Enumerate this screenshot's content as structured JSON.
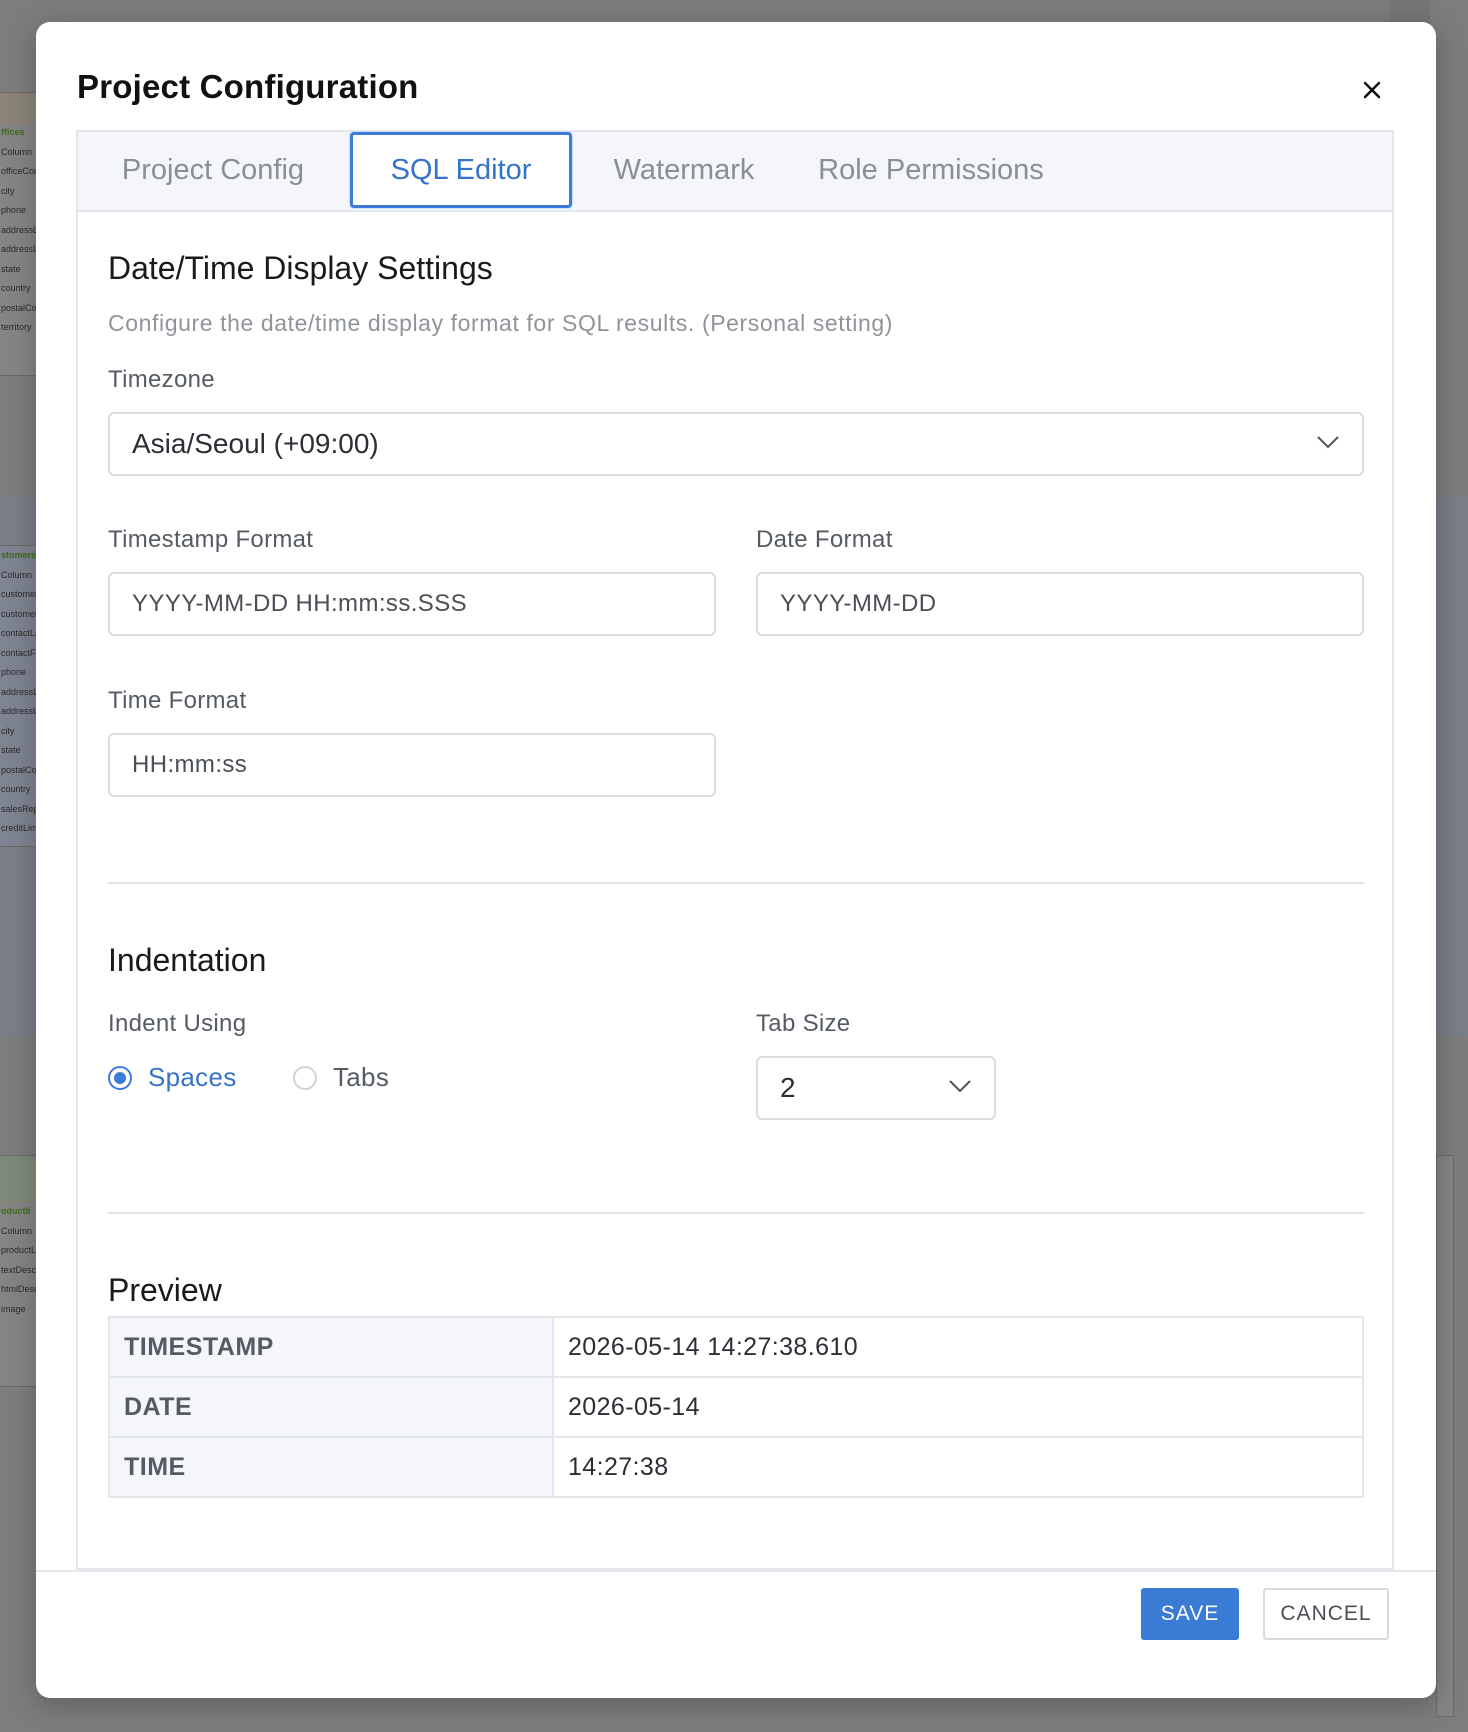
{
  "background": {
    "panel_1_title": "ffices",
    "panel_1_rows": [
      "Column",
      "officeCod",
      "city",
      "phone",
      "addressLi",
      "addressLi",
      "state",
      "country",
      "postalCod",
      "territory"
    ],
    "panel_2_title": "stomers",
    "panel_2_rows": [
      "Column",
      "customerN",
      "customerN",
      "contactLa",
      "contactFir",
      "phone",
      "addressLi",
      "addressLi",
      "city",
      "state",
      "postalCod",
      "country",
      "salesRepE",
      "creditLimi"
    ],
    "panel_3_title": "oductli",
    "panel_3_rows": [
      "Column",
      "productLi",
      "textDescri",
      "htmlDescr",
      "image"
    ]
  },
  "modal": {
    "title": "Project Configuration",
    "close_icon": "close-icon"
  },
  "tabs": [
    {
      "label": "Project Config",
      "active": false
    },
    {
      "label": "SQL Editor",
      "active": true
    },
    {
      "label": "Watermark",
      "active": false
    },
    {
      "label": "Role Permissions",
      "active": false
    }
  ],
  "datetime": {
    "title": "Date/Time Display Settings",
    "description": "Configure the date/time display format for SQL results. (Personal setting)",
    "timezone_label": "Timezone",
    "timezone_value": "Asia/Seoul (+09:00)",
    "timestamp_label": "Timestamp Format",
    "timestamp_value": "YYYY-MM-DD HH:mm:ss.SSS",
    "date_label": "Date Format",
    "date_value": "YYYY-MM-DD",
    "time_label": "Time Format",
    "time_value": "HH:mm:ss"
  },
  "indentation": {
    "title": "Indentation",
    "indent_label": "Indent Using",
    "option_spaces": "Spaces",
    "option_tabs": "Tabs",
    "selected": "Spaces",
    "tabsize_label": "Tab Size",
    "tabsize_value": "2"
  },
  "preview": {
    "title": "Preview",
    "rows": [
      {
        "key": "TIMESTAMP",
        "value": "2026-05-14 14:27:38.610"
      },
      {
        "key": "DATE",
        "value": "2026-05-14"
      },
      {
        "key": "TIME",
        "value": "14:27:38"
      }
    ]
  },
  "footer": {
    "save_label": "SAVE",
    "cancel_label": "CANCEL"
  },
  "colors": {
    "accent": "#3a7bd5",
    "overlay": "#7d7d7d"
  }
}
